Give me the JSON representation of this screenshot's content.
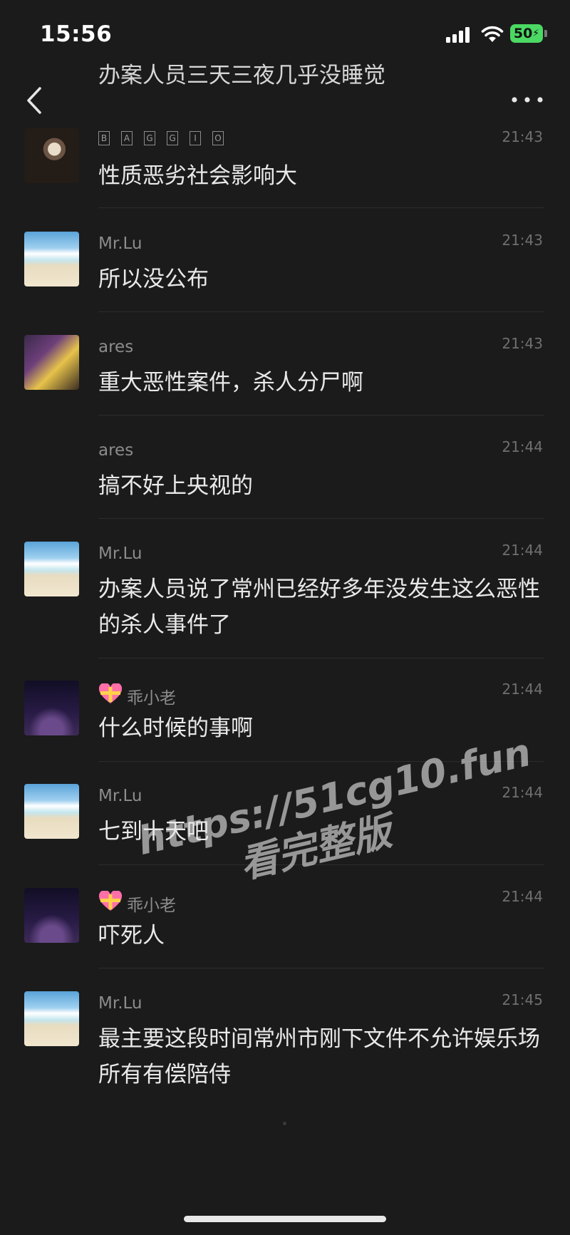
{
  "status_bar": {
    "time": "15:56",
    "battery": "50"
  },
  "previous_message_fragment": "办案人员三天三夜几乎没睡觉",
  "messages": [
    {
      "sender": "BAGGIO",
      "sender_glyphs": [
        "B",
        "A",
        "G",
        "G",
        "I",
        "O"
      ],
      "time": "21:43",
      "text": "性质恶劣社会影响大",
      "avatar": "baggio-photo"
    },
    {
      "sender": "Mr.Lu",
      "time": "21:43",
      "text": "所以没公布",
      "avatar": "beach-photo"
    },
    {
      "sender": "ares",
      "time": "21:43",
      "text": "重大恶性案件，杀人分尸啊",
      "avatar": "basketball-photo"
    },
    {
      "sender": "ares",
      "time": "21:44",
      "text": "搞不好上央视的",
      "avatar": ""
    },
    {
      "sender": "Mr.Lu",
      "time": "21:44",
      "text": "办案人员说了常州已经好多年没发生这么恶性的杀人事件了",
      "avatar": "beach-photo"
    },
    {
      "sender": "乖小老",
      "time": "21:44",
      "text": "什么时候的事啊",
      "avatar": "tower-photo",
      "badge": "heart-gift-icon"
    },
    {
      "sender": "Mr.Lu",
      "time": "21:44",
      "text": "七到十天吧",
      "avatar": "beach-photo"
    },
    {
      "sender": "乖小老",
      "time": "21:44",
      "text": "吓死人",
      "avatar": "tower-photo",
      "badge": "heart-gift-icon"
    },
    {
      "sender": "Mr.Lu",
      "time": "21:45",
      "text": "最主要这段时间常州市刚下文件不允许娱乐场所有有偿陪侍",
      "avatar": "beach-photo"
    }
  ],
  "watermark": {
    "url": "https://51cg10.fun",
    "cta": "看完整版"
  }
}
